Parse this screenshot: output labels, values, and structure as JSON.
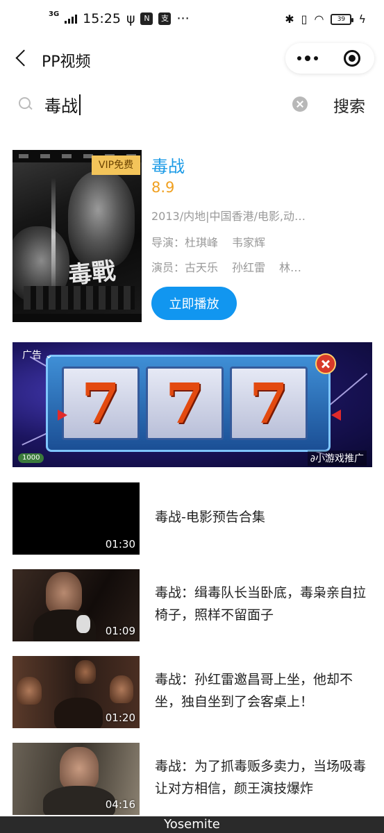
{
  "status_bar": {
    "network": "3G",
    "time": "15:25",
    "icon_a": "N",
    "icon_b": "支",
    "more": "···",
    "battery": "39"
  },
  "nav": {
    "title": "PP视频"
  },
  "search": {
    "query": "毒战",
    "button_label": "搜索"
  },
  "movie": {
    "poster_title": "毒戰",
    "vip_badge": "VIP免费",
    "title": "毒战",
    "score": "8.9",
    "meta": "2013/内地|中国香港/电影,动…",
    "director_label": "导演：",
    "director_1": "杜琪峰",
    "director_2": "韦家辉",
    "actors_label": "演员：",
    "actor_1": "古天乐",
    "actor_2": "孙红雷",
    "actor_3": "林…",
    "play_button": "立即播放"
  },
  "ad": {
    "label": "广告",
    "reels": [
      "7",
      "7",
      "7"
    ],
    "coins": "1000",
    "source": "小游戏推广"
  },
  "videos": [
    {
      "title": "毒战-电影预告合集",
      "duration": "01:30"
    },
    {
      "title": "毒战：缉毒队长当卧底，毒枭亲自拉椅子，照样不留面子",
      "duration": "01:09"
    },
    {
      "title": "毒战：孙红雷邀昌哥上坐，他却不坐，独自坐到了会客桌上！",
      "duration": "01:20"
    },
    {
      "title": "毒战：为了抓毒贩多卖力，当场吸毒让对方相信，颜王演技爆炸",
      "duration": "04:16"
    }
  ],
  "footer": {
    "label": "Yosemite"
  },
  "colors": {
    "accent_blue": "#1196f0",
    "title_blue": "#1a9ae6",
    "score_orange": "#f0a020",
    "vip_gold": "#f3c45a"
  }
}
